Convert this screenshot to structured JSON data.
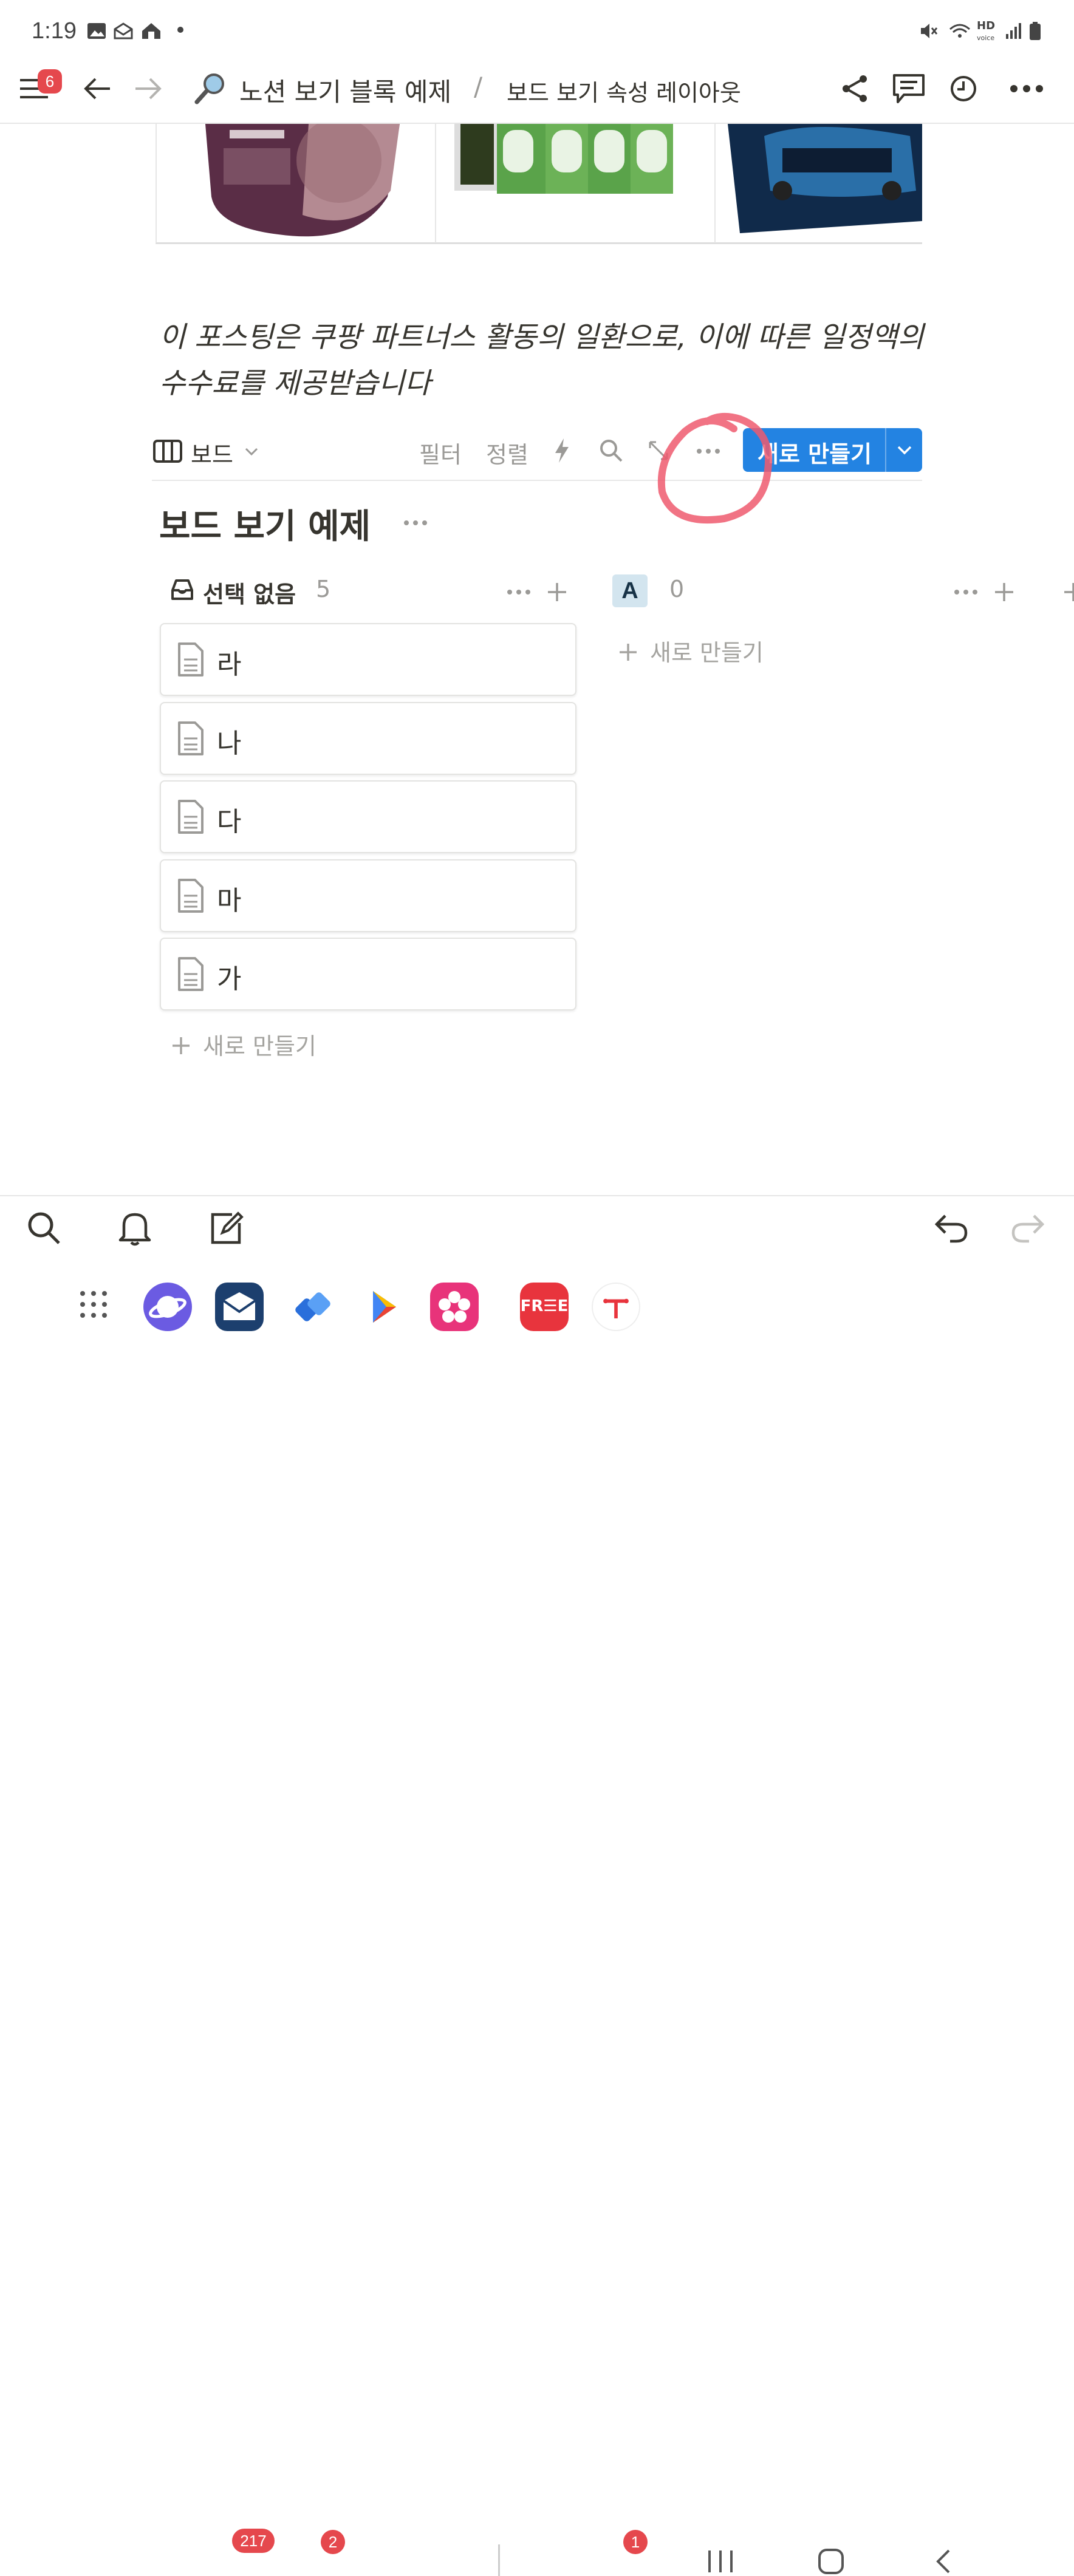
{
  "status": {
    "time": "1:19"
  },
  "nav": {
    "menu_badge": "6",
    "breadcrumb_page": "노션 보기 블록 예제",
    "breadcrumb_sep": "/",
    "breadcrumb_sub": "보드 보기 속성 레이아웃"
  },
  "note": {
    "line1": "이 포스팅은 쿠팡 파트너스 활동의 일환으로, 이에 따른 일정액의",
    "line2": "수수료를 제공받습니다"
  },
  "toolbar": {
    "view_label": "보드",
    "filter_label": "필터",
    "sort_label": "정렬",
    "new_label": "새로 만들기"
  },
  "board": {
    "title": "보드 보기 예제",
    "groups": [
      {
        "name": "선택 없음",
        "count": "5",
        "cards": [
          "라",
          "나",
          "다",
          "마",
          "가"
        ],
        "new_label": "새로 만들기"
      },
      {
        "name": "A",
        "count": "0",
        "new_label": "새로 만들기"
      }
    ]
  },
  "dock": {
    "mail_badge": "217",
    "tasks_badge": "2",
    "app_badge": "1",
    "free_label": "FR☰E"
  },
  "colors": {
    "accent": "#2383e2",
    "badge": "#e5484d",
    "annotation": "#ee5a6e"
  }
}
